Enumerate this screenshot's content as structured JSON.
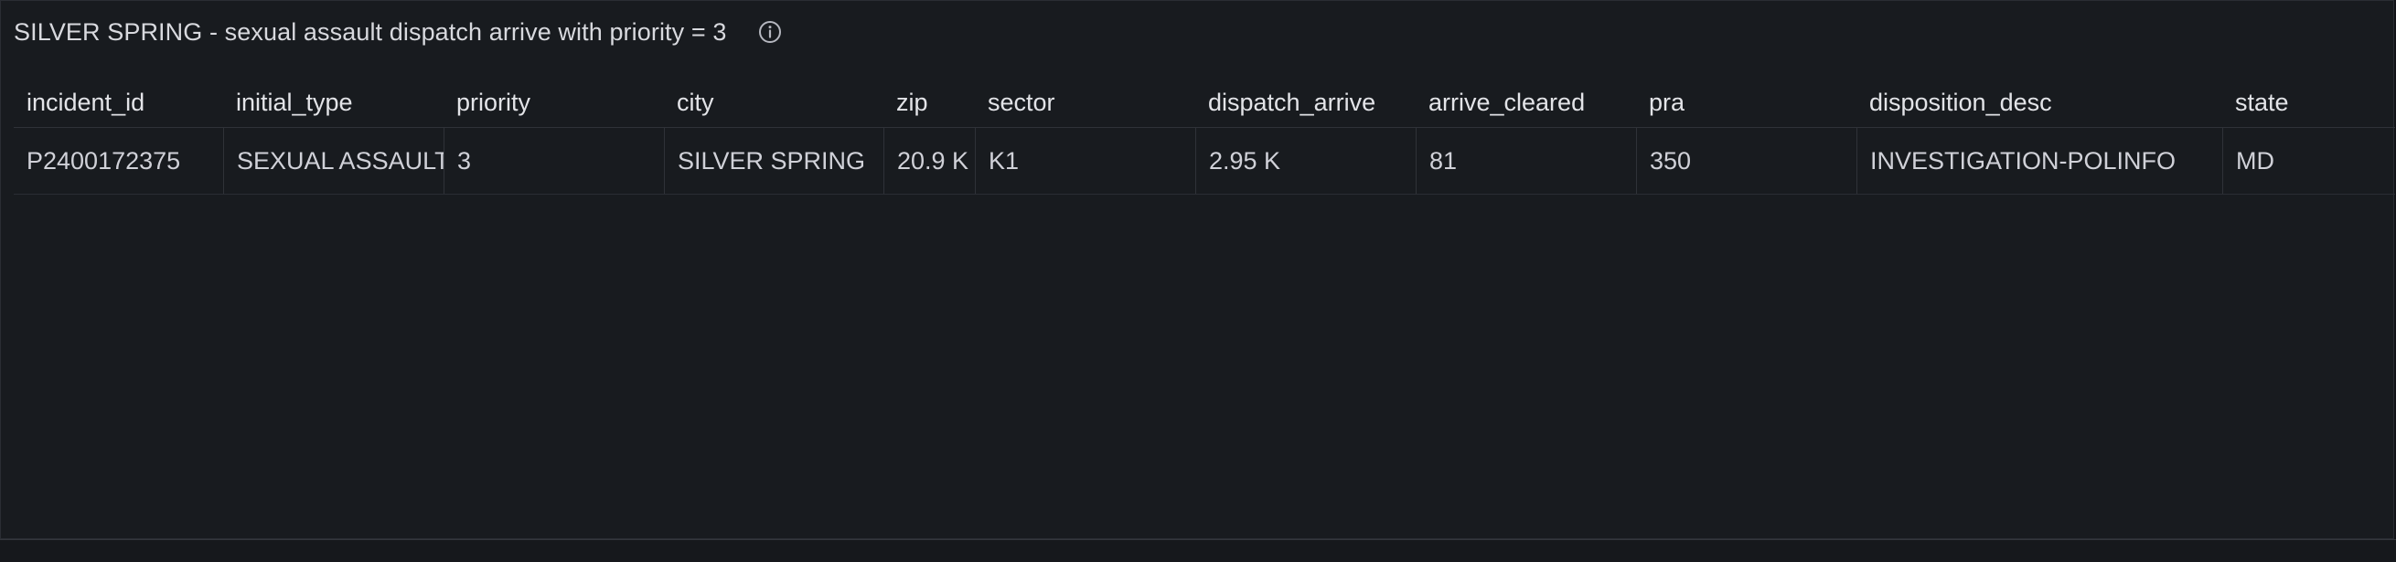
{
  "panel": {
    "title": "SILVER SPRING - sexual assault dispatch arrive with priority = 3",
    "info_icon": "info-circle-icon"
  },
  "table": {
    "columns": [
      "incident_id",
      "initial_type",
      "priority",
      "city",
      "zip",
      "sector",
      "dispatch_arrive",
      "arrive_cleared",
      "pra",
      "disposition_desc",
      "state"
    ],
    "rows": [
      [
        "P2400172375",
        "SEXUAL ASSAULT",
        "3",
        "SILVER SPRING",
        "20.9 K",
        "K1",
        "2.95 K",
        "81",
        "350",
        "INVESTIGATION-POLINFO",
        "MD"
      ]
    ]
  },
  "colors": {
    "background": "#111217",
    "panel": "#181b1f",
    "text": "#ccccdc",
    "border": "#2f3238"
  }
}
